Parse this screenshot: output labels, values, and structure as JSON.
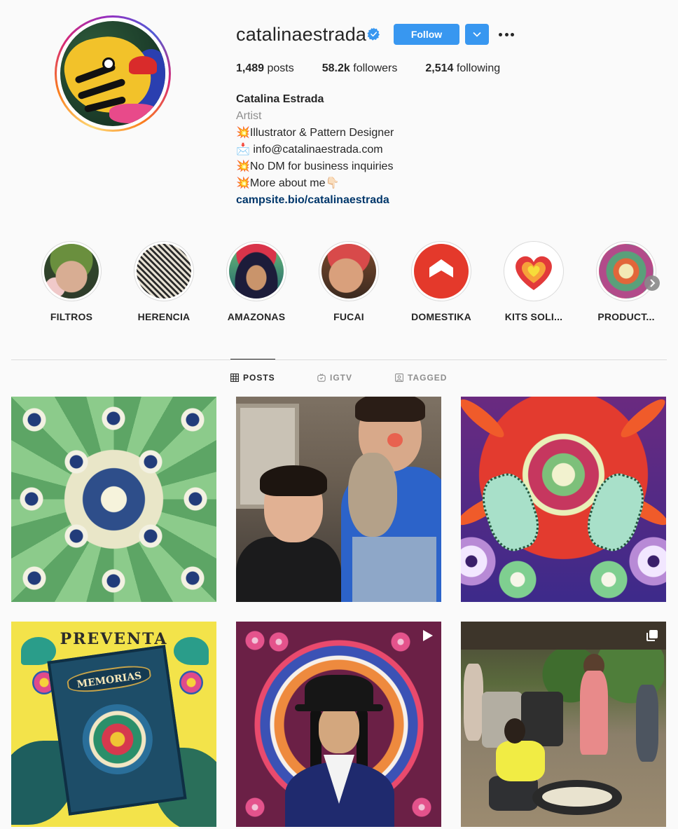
{
  "profile": {
    "username": "catalinaestrada",
    "follow_label": "Follow",
    "stats": {
      "posts_count": "1,489",
      "posts_label": "posts",
      "followers_count": "58.2k",
      "followers_label": "followers",
      "following_count": "2,514",
      "following_label": "following"
    },
    "full_name": "Catalina Estrada",
    "category": "Artist",
    "bio_lines": [
      "💥Illustrator & Pattern Designer",
      "📩 info@catalinaestrada.com",
      "💥No DM for business inquiries",
      "💥More about me👇🏻"
    ],
    "link": "campsite.bio/catalinaestrada"
  },
  "highlights": [
    {
      "label": "FILTROS"
    },
    {
      "label": "HERENCIA"
    },
    {
      "label": "AMAZONAS"
    },
    {
      "label": "FUCAI"
    },
    {
      "label": "DOMESTIKA"
    },
    {
      "label": "KITS SOLI..."
    },
    {
      "label": "PRODUCT..."
    }
  ],
  "tabs": [
    {
      "label": "POSTS",
      "icon": "grid-icon",
      "active": true
    },
    {
      "label": "IGTV",
      "icon": "igtv-icon",
      "active": false
    },
    {
      "label": "TAGGED",
      "icon": "tagged-icon",
      "active": false
    }
  ],
  "posts": [
    {
      "type": "image"
    },
    {
      "type": "image"
    },
    {
      "type": "image"
    },
    {
      "type": "image",
      "text": "PREVENTA",
      "book_title": "MEMORIAS"
    },
    {
      "type": "video",
      "icon": "video-icon"
    },
    {
      "type": "carousel",
      "icon": "carousel-icon"
    }
  ],
  "colors": {
    "accent": "#3897f0",
    "link": "#00376b",
    "secondary_text": "#8e8e8e",
    "divider": "#dbdbdb",
    "domestika_red": "#e4392b"
  }
}
